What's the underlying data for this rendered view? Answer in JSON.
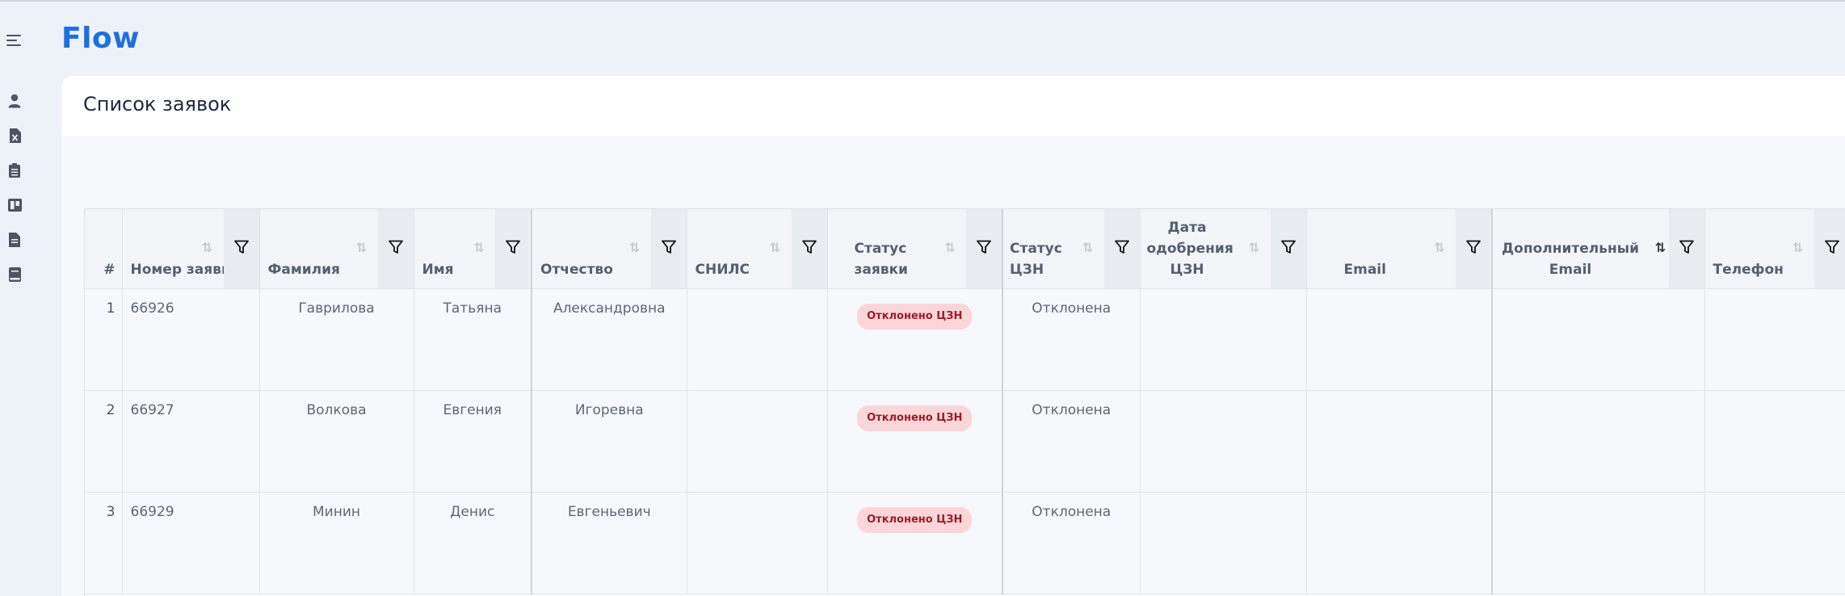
{
  "app": {
    "logo": "Flow"
  },
  "sidebar": {
    "items": [
      {
        "name": "menu-icon"
      },
      {
        "name": "user-icon"
      },
      {
        "name": "excel-file-icon"
      },
      {
        "name": "clipboard-list-icon"
      },
      {
        "name": "kanban-board-icon"
      },
      {
        "name": "document-icon"
      },
      {
        "name": "book-icon"
      }
    ]
  },
  "page": {
    "title": "Список заявок"
  },
  "table": {
    "columns": [
      {
        "key": "num",
        "label": "#"
      },
      {
        "key": "request_number",
        "label": "Номер заявки"
      },
      {
        "key": "last_name",
        "label": "Фамилия"
      },
      {
        "key": "first_name",
        "label": "Имя"
      },
      {
        "key": "patronymic",
        "label": "Отчество"
      },
      {
        "key": "snils",
        "label": "СНИЛС"
      },
      {
        "key": "request_status",
        "label": "Статус заявки"
      },
      {
        "key": "czn_status",
        "label": "Статус ЦЗН"
      },
      {
        "key": "approval_date",
        "label": "Дата одобрения ЦЗН"
      },
      {
        "key": "email",
        "label": "Email"
      },
      {
        "key": "additional_email",
        "label": "Дополнительный Email"
      },
      {
        "key": "phone",
        "label": "Телефон"
      }
    ],
    "rows": [
      {
        "num": "1",
        "request_number": "66926",
        "last_name": "Гаврилова",
        "first_name": "Татьяна",
        "patronymic": "Александровна",
        "snils": "",
        "request_status": "Отклонено ЦЗН",
        "czn_status": "Отклонена",
        "approval_date": "",
        "email": "",
        "additional_email": "",
        "phone": ""
      },
      {
        "num": "2",
        "request_number": "66927",
        "last_name": "Волкова",
        "first_name": "Евгения",
        "patronymic": "Игоревна",
        "snils": "",
        "request_status": "Отклонено ЦЗН",
        "czn_status": "Отклонена",
        "approval_date": "",
        "email": "",
        "additional_email": "",
        "phone": ""
      },
      {
        "num": "3",
        "request_number": "66929",
        "last_name": "Минин",
        "first_name": "Денис",
        "patronymic": "Евгеньевич",
        "snils": "",
        "request_status": "Отклонено ЦЗН",
        "czn_status": "Отклонена",
        "approval_date": "",
        "email": "",
        "additional_email": "",
        "phone": ""
      }
    ],
    "sort_glyph": "↓↑",
    "active_sort_column": "additional_email"
  },
  "colors": {
    "brand": "#1f6fe0",
    "badge_bg": "#fbd6d9",
    "badge_text": "#9a1c2c",
    "background": "#edf1f8"
  }
}
